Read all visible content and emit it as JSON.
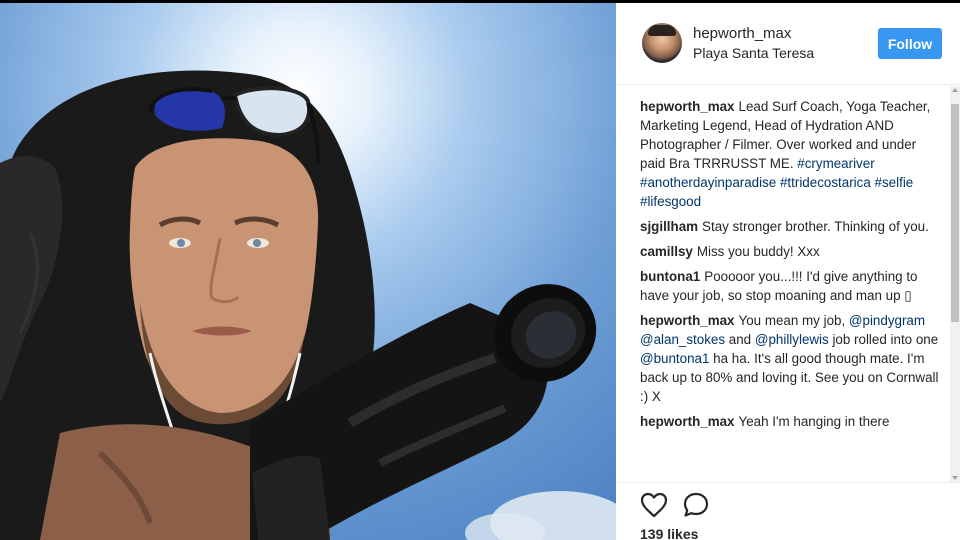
{
  "post": {
    "username": "hepworth_max",
    "location": "Playa Santa Teresa",
    "follow_label": "Follow",
    "likes": "139 likes"
  },
  "comments": [
    {
      "user": "hepworth_max",
      "parts": [
        {
          "text": "Lead Surf Coach, Yoga Teacher, Marketing Legend, Head of Hydration AND Photographer / Filmer. Over worked and under paid Bra TRRRUSST ME. "
        },
        {
          "text": "#crymeariver",
          "tag": true
        },
        {
          "text": " "
        },
        {
          "text": "#anotherdayinparadise",
          "tag": true
        },
        {
          "text": " "
        },
        {
          "text": "#ttridecostarica",
          "tag": true
        },
        {
          "text": " "
        },
        {
          "text": "#selfie",
          "tag": true
        },
        {
          "text": " "
        },
        {
          "text": "#lifesgood",
          "tag": true
        }
      ]
    },
    {
      "user": "sjgillham",
      "parts": [
        {
          "text": "Stay stronger brother. Thinking of you."
        }
      ]
    },
    {
      "user": "camillsy",
      "parts": [
        {
          "text": "Miss you buddy! Xxx"
        }
      ]
    },
    {
      "user": "buntona1",
      "parts": [
        {
          "text": "Pooooor you...!!! I'd give anything to have your job, so stop moaning and man up ▯"
        }
      ]
    },
    {
      "user": "hepworth_max",
      "parts": [
        {
          "text": "You mean my job, "
        },
        {
          "text": "@pindygram",
          "tag": true
        },
        {
          "text": " "
        },
        {
          "text": "@alan_stokes",
          "tag": true
        },
        {
          "text": " and "
        },
        {
          "text": "@phillylewis",
          "tag": true
        },
        {
          "text": " job rolled into one "
        },
        {
          "text": "@buntona1",
          "tag": true
        },
        {
          "text": " ha ha. It's all good though mate. I'm back up to 80% and loving it. See you on Cornwall :) X"
        }
      ]
    },
    {
      "user": "hepworth_max",
      "parts": [
        {
          "text": "Yeah I'm hanging in there"
        }
      ]
    }
  ],
  "colors": {
    "accent": "#3897f0",
    "tag": "#003569",
    "text": "#262626"
  },
  "icons": [
    "heart-icon",
    "comment-icon"
  ]
}
